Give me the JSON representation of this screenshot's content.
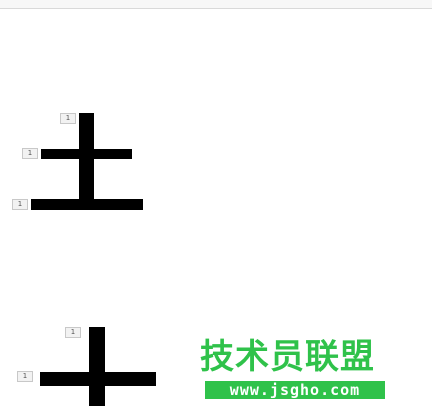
{
  "glyph_top": {
    "tags": [
      "1",
      "1",
      "1"
    ]
  },
  "glyph_bottom": {
    "tags": [
      "1",
      "1"
    ]
  },
  "watermark": {
    "title": "技术员联盟",
    "url": "www.jsgho.com",
    "color": "#2fc24a"
  }
}
